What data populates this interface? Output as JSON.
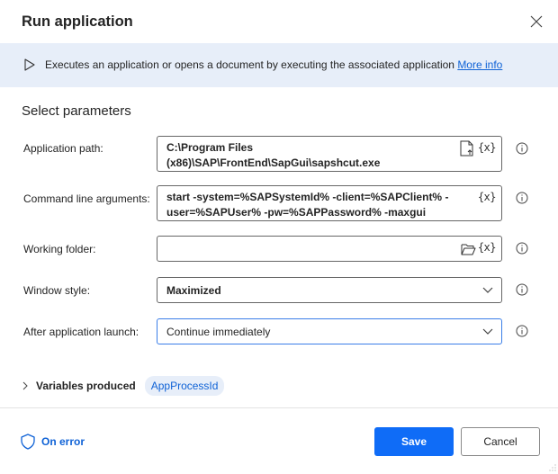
{
  "dialog": {
    "title": "Run application",
    "close_icon": "close-icon"
  },
  "banner": {
    "icon": "play-icon",
    "description": "Executes an application or opens a document by executing the associated application",
    "more_info_label": "More info"
  },
  "section_title": "Select parameters",
  "fields": {
    "application_path": {
      "label": "Application path:",
      "value": "C:\\Program Files (x86)\\SAP\\FrontEnd\\SapGui\\sapshcut.exe",
      "icons": [
        "file-select-icon",
        "variable-icon"
      ],
      "var_button": "{x}"
    },
    "command_line_arguments": {
      "label": "Command line arguments:",
      "value": "start -system=%SAPSystemId% -client=%SAPClient% -user=%SAPUser% -pw=%SAPPassword% -maxgui",
      "var_button": "{x}"
    },
    "working_folder": {
      "label": "Working folder:",
      "value": "",
      "icons": [
        "folder-icon",
        "variable-icon"
      ],
      "var_button": "{x}"
    },
    "window_style": {
      "label": "Window style:",
      "selected": "Maximized"
    },
    "after_application_launch": {
      "label": "After application launch:",
      "selected": "Continue immediately"
    }
  },
  "variables_produced": {
    "label": "Variables produced",
    "variables": [
      "AppProcessId"
    ]
  },
  "footer": {
    "on_error_label": "On error",
    "save_label": "Save",
    "cancel_label": "Cancel"
  },
  "colors": {
    "accent": "#0f6cf7",
    "link": "#0f62d6",
    "banner_bg": "#e7eef9"
  }
}
